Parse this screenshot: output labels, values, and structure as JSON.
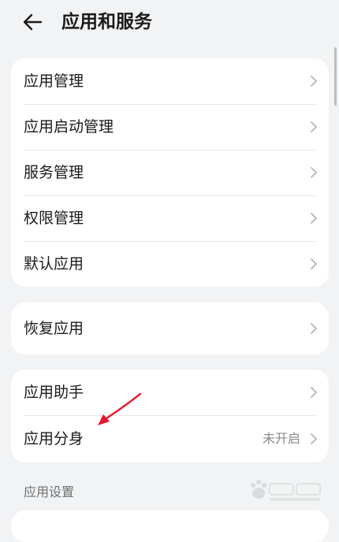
{
  "header": {
    "back_icon": "arrow-left-icon",
    "title": "应用和服务"
  },
  "card_main": {
    "items": [
      {
        "label": "应用管理",
        "icon": "chevron-right-icon"
      },
      {
        "label": "应用启动管理",
        "icon": "chevron-right-icon"
      },
      {
        "label": "服务管理",
        "icon": "chevron-right-icon"
      },
      {
        "label": "权限管理",
        "icon": "chevron-right-icon"
      },
      {
        "label": "默认应用",
        "icon": "chevron-right-icon"
      }
    ]
  },
  "card_restore": {
    "items": [
      {
        "label": "恢复应用",
        "icon": "chevron-right-icon"
      }
    ]
  },
  "card_assist": {
    "items": [
      {
        "label": "应用助手",
        "icon": "chevron-right-icon"
      },
      {
        "label": "应用分身",
        "value": "未开启",
        "icon": "chevron-right-icon"
      }
    ]
  },
  "section": {
    "app_settings_label": "应用设置"
  },
  "annotation": {
    "arrow_color": "#e8192c"
  },
  "colors": {
    "background": "#f1f3f5",
    "card": "#ffffff",
    "text_primary": "#1a1a1a",
    "text_secondary": "#8a8a8a"
  }
}
